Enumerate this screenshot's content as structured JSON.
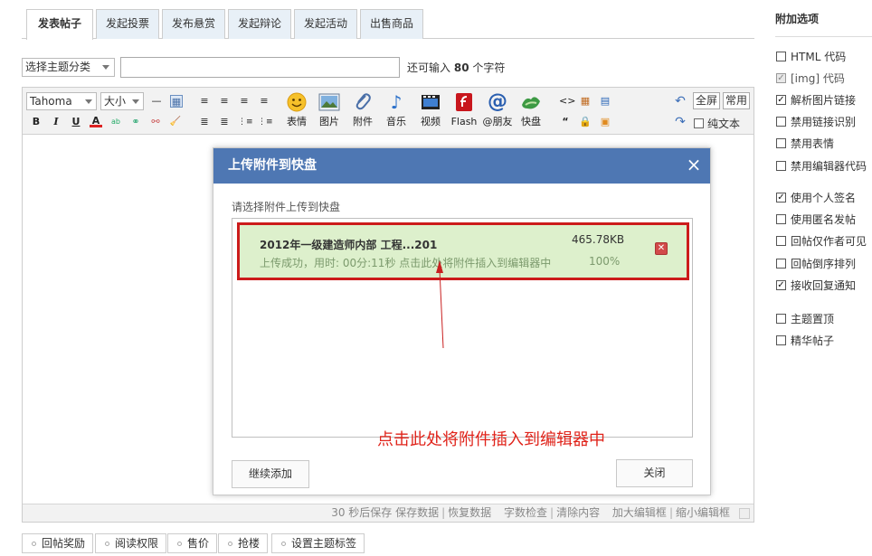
{
  "tabs": [
    {
      "label": "发表帖子",
      "active": true
    },
    {
      "label": "发起投票",
      "active": false
    },
    {
      "label": "发布悬赏",
      "active": false
    },
    {
      "label": "发起辩论",
      "active": false
    },
    {
      "label": "发起活动",
      "active": false
    },
    {
      "label": "出售商品",
      "active": false
    }
  ],
  "subject": {
    "category_select": "选择主题分类",
    "title_value": "",
    "hint_prefix": "还可输入",
    "hint_count": "80",
    "hint_suffix": "个字符"
  },
  "toolbar": {
    "font_family": "Tahoma",
    "font_size": "大小",
    "small_buttons_row1": [
      "—",
      "▦",
      "≡",
      "≡",
      "≡",
      "≡"
    ],
    "small_buttons_row2": [
      "B",
      "I",
      "U",
      "A",
      "ab",
      "⚭",
      "⚯",
      "🧹",
      "≣",
      "≣",
      "⋮≡",
      "⋮≡"
    ],
    "big_buttons": [
      {
        "label": "表情",
        "icon": "smiley-icon"
      },
      {
        "label": "图片",
        "icon": "image-icon"
      },
      {
        "label": "附件",
        "icon": "paperclip-icon"
      },
      {
        "label": "音乐",
        "icon": "music-note-icon"
      },
      {
        "label": "视频",
        "icon": "film-icon"
      },
      {
        "label": "Flash",
        "icon": "flash-icon"
      },
      {
        "label": "@朋友",
        "icon": "at-sign-icon"
      },
      {
        "label": "快盘",
        "icon": "kuaipan-icon"
      }
    ],
    "fullscreen": "全屏",
    "common": "常用",
    "plain_text": "纯文本"
  },
  "status_bar": {
    "autosave": "30 秒后保存",
    "links": [
      "保存数据",
      "恢复数据",
      "字数检查",
      "清除内容",
      "加大编辑框",
      "缩小编辑框"
    ]
  },
  "dialog": {
    "title": "上传附件到快盘",
    "close": "×",
    "subtitle": "请选择附件上传到快盘",
    "file": {
      "name": "2012年一级建造师内部 工程...201",
      "size": "465.78KB",
      "status": "上传成功，用时: 00分:11秒  点击此处将附件插入到编辑器中",
      "percent": "100%"
    },
    "annotation": "点击此处将附件插入到编辑器中",
    "continue_button": "继续添加",
    "close_button": "关闭"
  },
  "bottom_buttons": [
    "回帖奖励",
    "阅读权限",
    "售价",
    "抢楼",
    "设置主题标签"
  ],
  "sidebar": {
    "title": "附加选项",
    "options": [
      {
        "label": "HTML 代码",
        "checked": false,
        "disabled": false
      },
      {
        "label": "[img] 代码",
        "checked": true,
        "disabled": true
      },
      {
        "label": "解析图片链接",
        "checked": true,
        "disabled": false
      },
      {
        "label": "禁用链接识别",
        "checked": false,
        "disabled": false
      },
      {
        "label": "禁用表情",
        "checked": false,
        "disabled": false
      },
      {
        "label": "禁用编辑器代码",
        "checked": false,
        "disabled": false
      },
      {
        "label": "使用个人签名",
        "checked": true,
        "disabled": false
      },
      {
        "label": "使用匿名发帖",
        "checked": false,
        "disabled": false
      },
      {
        "label": "回帖仅作者可见",
        "checked": false,
        "disabled": false
      },
      {
        "label": "回帖倒序排列",
        "checked": false,
        "disabled": false
      },
      {
        "label": "接收回复通知",
        "checked": true,
        "disabled": false
      },
      {
        "label": "主题置顶",
        "checked": false,
        "disabled": false
      },
      {
        "label": "精华帖子",
        "checked": false,
        "disabled": false
      }
    ]
  },
  "colors": {
    "dialog_header": "#4e77b3",
    "highlight_border": "#cc1b1b",
    "success_bg": "#ddf0cc",
    "annotation": "#e0241b"
  }
}
